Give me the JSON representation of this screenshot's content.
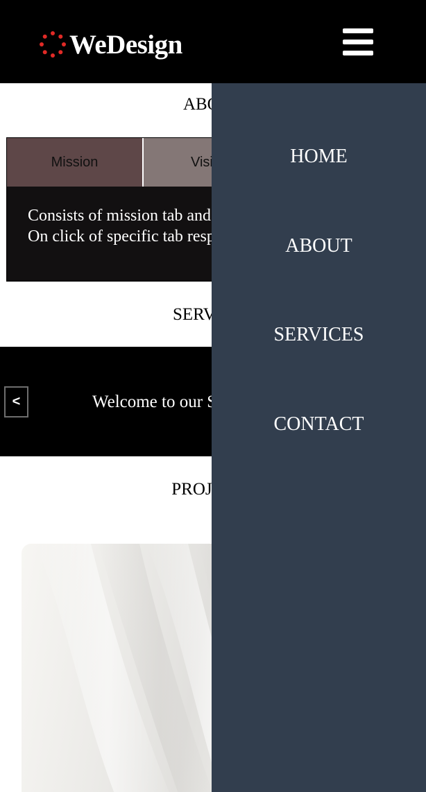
{
  "header": {
    "brand": "WeDesign",
    "logo_icon": "dotted-circle-logo",
    "logo_accent_color": "#e02a26",
    "menu_icon": "hamburger-menu-icon"
  },
  "about": {
    "heading": "ABOUT",
    "tabs": [
      {
        "label": "Mission"
      },
      {
        "label": "Vision"
      }
    ],
    "content": "Consists of mission tab and vision tab varies. On click of specific tab respective information"
  },
  "services": {
    "heading": "SERVICES",
    "slider_prev_label": "<",
    "slide_text": "Welcome to our Services"
  },
  "projects": {
    "heading": "PROJECTS"
  },
  "nav": {
    "background_color": "#323e4e",
    "items": [
      {
        "label": "HOME"
      },
      {
        "label": "ABOUT"
      },
      {
        "label": "SERVICES"
      },
      {
        "label": "CONTACT"
      }
    ]
  }
}
